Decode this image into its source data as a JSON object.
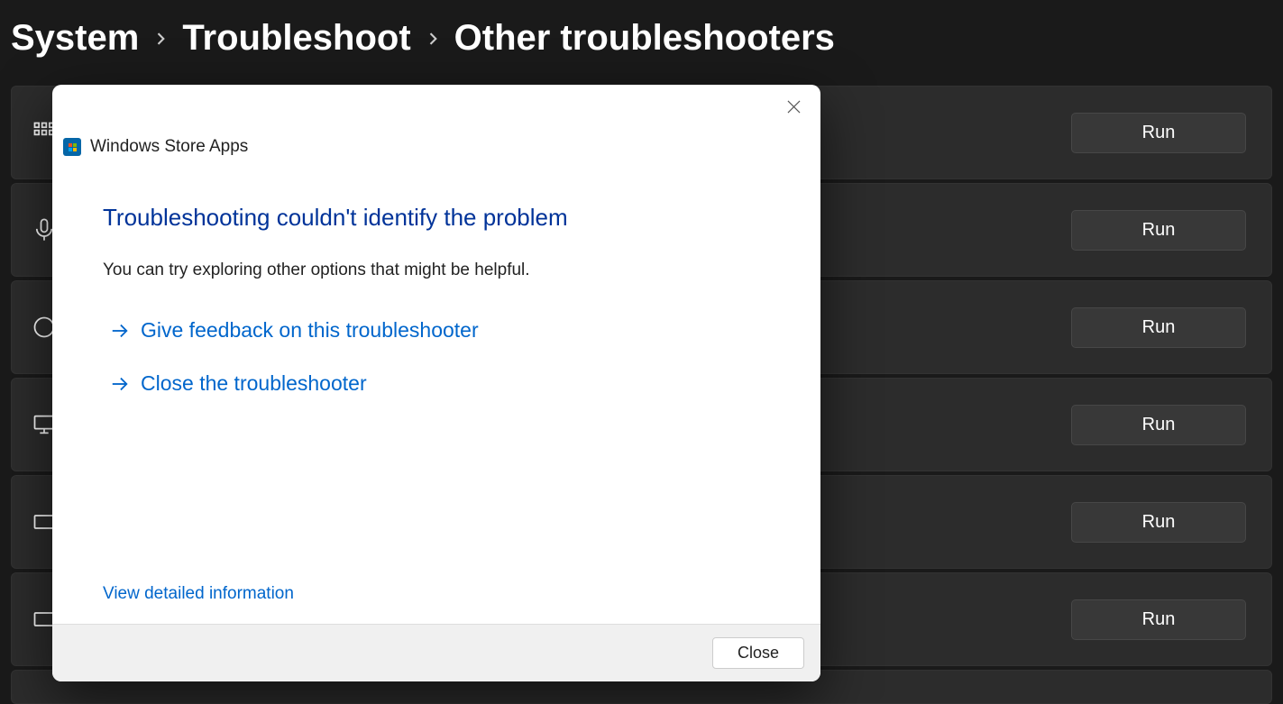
{
  "breadcrumb": {
    "items": [
      {
        "label": "System"
      },
      {
        "label": "Troubleshoot"
      },
      {
        "label": "Other troubleshooters"
      }
    ]
  },
  "rows": [
    {
      "icon": "grid-icon",
      "run_label": "Run"
    },
    {
      "icon": "microphone-icon",
      "run_label": "Run"
    },
    {
      "icon": "circle-icon",
      "run_label": "Run"
    },
    {
      "icon": "monitor-icon",
      "run_label": "Run"
    },
    {
      "icon": "rectangle-icon",
      "run_label": "Run"
    },
    {
      "icon": "rectangle-icon",
      "run_label": "Run"
    }
  ],
  "dialog": {
    "app_name": "Windows Store Apps",
    "title": "Troubleshooting couldn't identify the problem",
    "subtext": "You can try exploring other options that might be helpful.",
    "actions": [
      {
        "label": "Give feedback on this troubleshooter"
      },
      {
        "label": "Close the troubleshooter"
      }
    ],
    "detail_link": "View detailed information",
    "close_label": "Close"
  }
}
